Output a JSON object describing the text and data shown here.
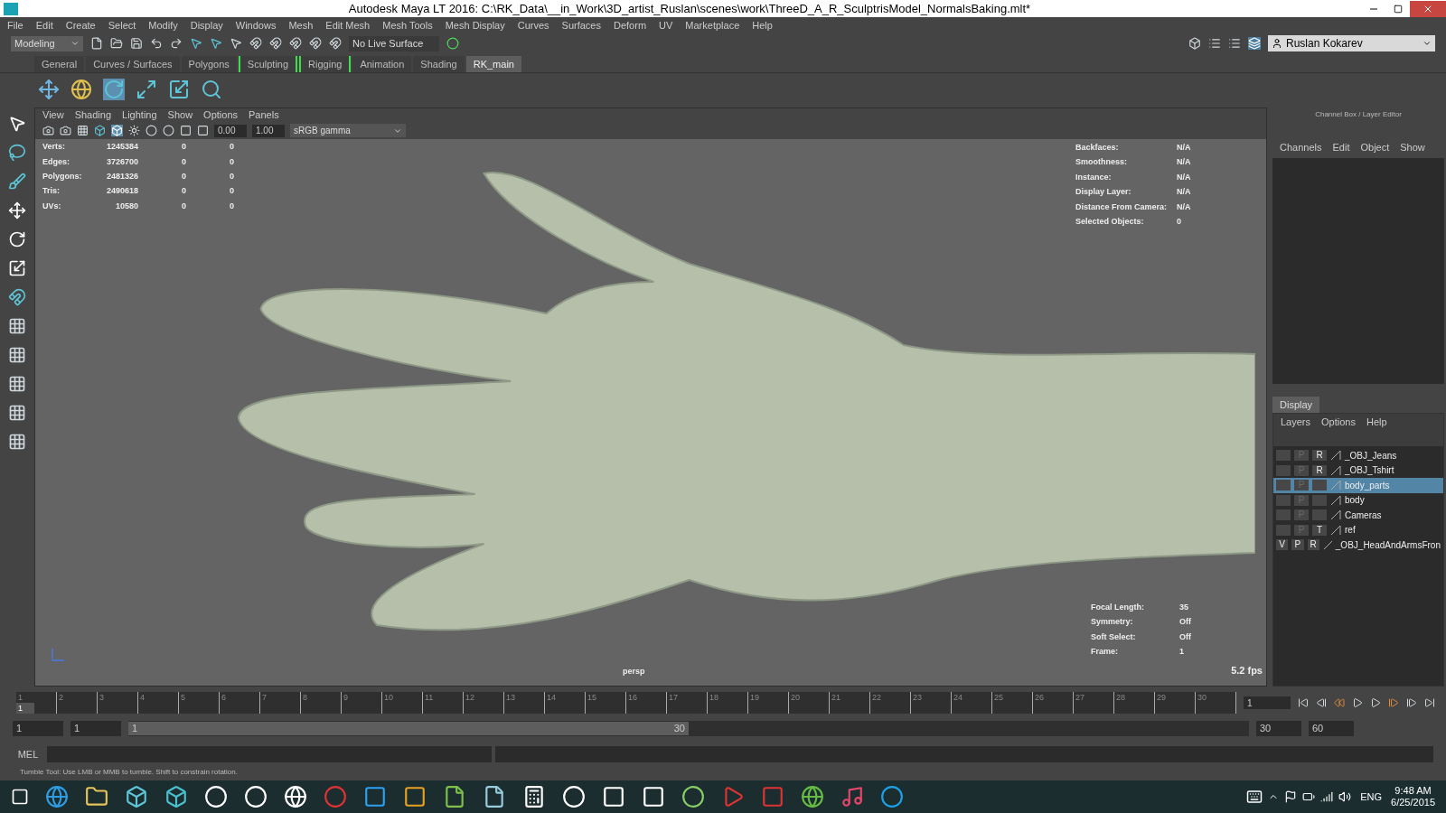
{
  "window": {
    "title": "Autodesk Maya LT 2016: C:\\RK_Data\\__in_Work\\3D_artist_Ruslan\\scenes\\work\\ThreeD_A_R_SculptrisModel_NormalsBaking.mlt*"
  },
  "menu": [
    "File",
    "Edit",
    "Create",
    "Select",
    "Modify",
    "Display",
    "Windows",
    "Mesh",
    "Edit Mesh",
    "Mesh Tools",
    "Mesh Display",
    "Curves",
    "Surfaces",
    "Deform",
    "UV",
    "Marketplace",
    "Help"
  ],
  "toolbar": {
    "mode": "Modeling",
    "live_surface": "No Live Surface",
    "user": "Ruslan Kokarev"
  },
  "shelf_tabs": [
    {
      "label": "General",
      "selected": false,
      "bracketed": false
    },
    {
      "label": "Curves / Surfaces",
      "selected": false,
      "bracketed": false
    },
    {
      "label": "Polygons",
      "selected": false,
      "bracketed": false
    },
    {
      "label": "Sculpting",
      "selected": false,
      "bracketed": true
    },
    {
      "label": "Rigging",
      "selected": false,
      "bracketed": true
    },
    {
      "label": "Animation",
      "selected": false,
      "bracketed": false
    },
    {
      "label": "Shading",
      "selected": false,
      "bracketed": false
    },
    {
      "label": "RK_main",
      "selected": true,
      "bracketed": false
    }
  ],
  "viewport": {
    "menu": [
      "View",
      "Shading",
      "Lighting",
      "Show",
      "Options",
      "Panels"
    ],
    "exposure": "0.00",
    "gamma": "1.00",
    "color_space": "sRGB gamma",
    "stats": [
      {
        "label": "Verts:",
        "values": [
          "1245384",
          "0",
          "0"
        ]
      },
      {
        "label": "Edges:",
        "values": [
          "3726700",
          "0",
          "0"
        ]
      },
      {
        "label": "Polygons:",
        "values": [
          "2481326",
          "0",
          "0"
        ]
      },
      {
        "label": "Tris:",
        "values": [
          "2490618",
          "0",
          "0"
        ]
      },
      {
        "label": "UVs:",
        "values": [
          "10580",
          "0",
          "0"
        ]
      }
    ],
    "info": [
      {
        "label": "Backfaces:",
        "value": "N/A"
      },
      {
        "label": "Smoothness:",
        "value": "N/A"
      },
      {
        "label": "Instance:",
        "value": "N/A"
      },
      {
        "label": "Display Layer:",
        "value": "N/A"
      },
      {
        "label": "Distance From Camera:",
        "value": "N/A"
      },
      {
        "label": "Selected Objects:",
        "value": "0"
      }
    ],
    "camera_info": [
      {
        "label": "Focal Length:",
        "value": "35"
      },
      {
        "label": "Symmetry:",
        "value": "Off"
      },
      {
        "label": "Soft Select:",
        "value": "Off"
      },
      {
        "label": "Frame:",
        "value": "1"
      }
    ],
    "camera": "persp",
    "fps": "5.2 fps"
  },
  "channel_box": {
    "title": "Channel Box / Layer Editor",
    "menu": [
      "Channels",
      "Edit",
      "Object",
      "Show"
    ]
  },
  "layer_editor": {
    "tab": "Display",
    "menu": [
      "Layers",
      "Options",
      "Help"
    ],
    "layers": [
      {
        "name": "_OBJ_Jeans",
        "selected": false,
        "p": "P",
        "p_on": false,
        "t": "R"
      },
      {
        "name": "_OBJ_Tshirt",
        "selected": false,
        "p": "P",
        "p_on": false,
        "t": "R"
      },
      {
        "name": "body_parts",
        "selected": true,
        "p": "P",
        "p_on": false
      },
      {
        "name": "body",
        "selected": false,
        "p": "P",
        "p_on": false
      },
      {
        "name": "Cameras",
        "selected": false,
        "p": "P",
        "p_on": false
      },
      {
        "name": "ref",
        "selected": false,
        "p": "P",
        "p_on": false,
        "t": "T"
      },
      {
        "name": "_OBJ_HeadAndArmsFron",
        "selected": false,
        "v": "V",
        "p": "P",
        "p_on": true,
        "t": "R"
      }
    ]
  },
  "timeline": {
    "ticks": [
      "1",
      "2",
      "3",
      "4",
      "5",
      "6",
      "7",
      "8",
      "9",
      "10",
      "11",
      "12",
      "13",
      "14",
      "15",
      "16",
      "17",
      "18",
      "19",
      "20",
      "21",
      "22",
      "23",
      "24",
      "25",
      "26",
      "27",
      "28",
      "29",
      "30"
    ],
    "current": "1",
    "level": 0,
    "current_field": "1"
  },
  "range": {
    "start": "1",
    "inner_start": "1",
    "bar_start": "1",
    "bar_end": "30",
    "inner_end": "30",
    "end": "60",
    "level": 0.5
  },
  "command_line": {
    "label": "MEL"
  },
  "help_line": "Tumble Tool: Use LMB or MMB to tumble. Shift to constrain rotation.",
  "taskbar": {
    "language": "ENG",
    "time": "9:48 AM",
    "date": "6/25/2015"
  }
}
